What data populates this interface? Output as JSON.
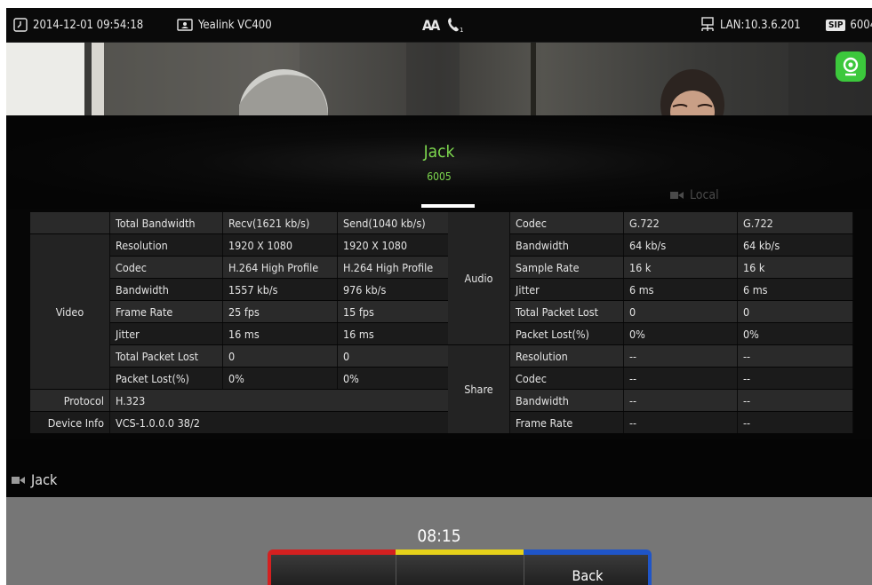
{
  "status_bar": {
    "datetime": "2014-12-01 09:54:18",
    "device_name": "Yealink VC400",
    "center_indicator": "AA",
    "network": "LAN:10.3.6.201",
    "sip_badge": "SIP",
    "sip_account": "6004",
    "icons": [
      "clock-icon",
      "device-icon",
      "auto-answer-icon",
      "handset-icon",
      "lan-icon",
      "sip-icon",
      "camera-icon"
    ]
  },
  "caller": {
    "name": "Jack",
    "number": "6005",
    "local_label": "Local"
  },
  "video_stats": {
    "header": {
      "label": "Total Bandwidth",
      "recv": "Recv(1621 kb/s)",
      "send": "Send(1040 kb/s)"
    },
    "group": "Video",
    "rows": [
      {
        "label": "Resolution",
        "recv": "1920 X 1080",
        "send": "1920 X 1080"
      },
      {
        "label": "Codec",
        "recv": "H.264 High Profile",
        "send": "H.264 High Profile"
      },
      {
        "label": "Bandwidth",
        "recv": "1557 kb/s",
        "send": "976 kb/s"
      },
      {
        "label": "Frame Rate",
        "recv": "25 fps",
        "send": "15 fps"
      },
      {
        "label": "Jitter",
        "recv": "16 ms",
        "send": "16 ms"
      },
      {
        "label": "Total Packet Lost",
        "recv": "0",
        "send": "0"
      },
      {
        "label": "Packet Lost(%)",
        "recv": "0%",
        "send": "0%"
      }
    ],
    "protocol": {
      "label": "Protocol",
      "value": "H.323"
    },
    "device_info": {
      "label": "Device Info",
      "value": "VCS-1.0.0.0  38/2"
    }
  },
  "audio_stats": {
    "group": "Audio",
    "rows": [
      {
        "label": "Codec",
        "recv": "G.722",
        "send": "G.722"
      },
      {
        "label": "Bandwidth",
        "recv": "64 kb/s",
        "send": "64 kb/s"
      },
      {
        "label": "Sample Rate",
        "recv": "16 k",
        "send": "16 k"
      },
      {
        "label": "Jitter",
        "recv": "6 ms",
        "send": "6 ms"
      },
      {
        "label": "Total Packet Lost",
        "recv": "0",
        "send": "0"
      },
      {
        "label": "Packet Lost(%)",
        "recv": "0%",
        "send": "0%"
      }
    ]
  },
  "share_stats": {
    "group": "Share",
    "rows": [
      {
        "label": "Resolution",
        "recv": "--",
        "send": "--"
      },
      {
        "label": "Codec",
        "recv": "--",
        "send": "--"
      },
      {
        "label": "Bandwidth",
        "recv": "--",
        "send": "--"
      },
      {
        "label": "Frame Rate",
        "recv": "--",
        "send": "--"
      }
    ]
  },
  "remote_label": "Jack",
  "call_timer": "08:15",
  "softkeys": [
    {
      "label": "",
      "color": "#d42020"
    },
    {
      "label": "",
      "color": "#e6d21a"
    },
    {
      "label": "Back",
      "color": "#1f55c8"
    }
  ],
  "colors": {
    "accent_green": "#7dd84e",
    "camera_badge": "#3cc83c"
  }
}
